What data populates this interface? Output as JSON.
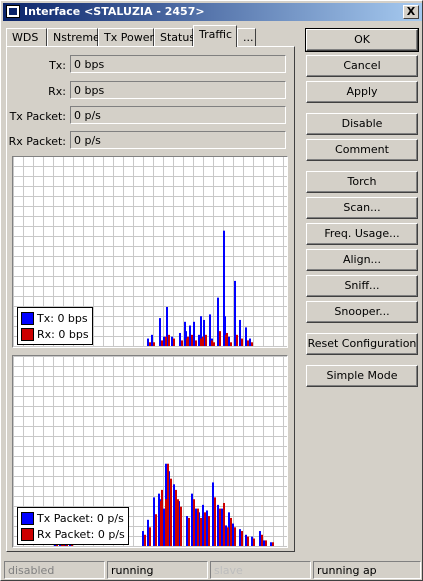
{
  "window": {
    "title": "Interface <STALUZIA - 2457>",
    "close_label": "X"
  },
  "tabs": [
    "WDS",
    "Nstreme",
    "Tx Power",
    "Status",
    "Traffic",
    "..."
  ],
  "active_tab": "Traffic",
  "fields": [
    {
      "label": "Tx:",
      "value": "0 bps"
    },
    {
      "label": "Rx:",
      "value": "0 bps"
    },
    {
      "label": "Tx Packet:",
      "value": "0 p/s"
    },
    {
      "label": "Rx Packet:",
      "value": "0 p/s"
    }
  ],
  "graphs": {
    "traffic": {
      "legend": [
        {
          "label": "Tx:",
          "value": "0 bps",
          "color": "#0000ff"
        },
        {
          "label": "Rx:",
          "value": "0 bps",
          "color": "#cc0000"
        }
      ]
    },
    "packets": {
      "legend": [
        {
          "label": "Tx Packet:",
          "value": "0 p/s",
          "color": "#0000ff"
        },
        {
          "label": "Rx Packet:",
          "value": "0 p/s",
          "color": "#cc0000"
        }
      ]
    }
  },
  "chart_data": [
    {
      "type": "bar",
      "name": "traffic-graph",
      "ylim": [
        0,
        100
      ],
      "grid": true,
      "x": [
        134,
        138,
        146,
        150,
        153,
        158,
        166,
        171,
        172,
        176,
        180,
        185,
        187,
        190,
        196,
        198,
        204,
        210,
        211,
        215,
        221,
        226,
        232,
        236
      ],
      "series": [
        {
          "name": "Tx",
          "color": "#0000ff",
          "values": [
            4,
            6,
            15,
            5,
            21,
            5,
            7,
            13,
            8,
            11,
            13,
            6,
            16,
            14,
            17,
            4,
            26,
            62,
            16,
            5,
            35,
            14,
            10,
            4
          ]
        },
        {
          "name": "Rx",
          "color": "#cc0000",
          "values": [
            2,
            2,
            3,
            5,
            6,
            4,
            3,
            4,
            5,
            6,
            3,
            4,
            5,
            6,
            3,
            2,
            8,
            6,
            7,
            2,
            6,
            4,
            3,
            2
          ]
        }
      ]
    },
    {
      "type": "bar",
      "name": "packet-graph",
      "ylim": [
        0,
        100
      ],
      "grid": true,
      "x": [
        41,
        46,
        48,
        51,
        56,
        129,
        134,
        140,
        145,
        146,
        150,
        152,
        155,
        160,
        162,
        165,
        173,
        178,
        182,
        185,
        189,
        193,
        199,
        204,
        208,
        212,
        215,
        219,
        226,
        232,
        238,
        246,
        250,
        257
      ],
      "series": [
        {
          "name": "Tx Packet",
          "color": "#0000ff",
          "values": [
            6,
            7,
            6,
            9,
            4,
            8,
            14,
            26,
            28,
            25,
            20,
            44,
            40,
            33,
            28,
            24,
            16,
            28,
            20,
            18,
            22,
            19,
            34,
            22,
            20,
            11,
            18,
            12,
            9,
            6,
            5,
            8,
            3,
            2
          ]
        },
        {
          "name": "Rx Packet",
          "color": "#cc0000",
          "values": [
            8,
            7,
            10,
            5,
            3,
            6,
            10,
            17,
            24,
            30,
            25,
            44,
            36,
            30,
            25,
            21,
            15,
            25,
            20,
            15,
            18,
            16,
            26,
            20,
            23,
            10,
            15,
            10,
            8,
            5,
            4,
            6,
            3,
            2
          ]
        }
      ]
    }
  ],
  "buttons": [
    "OK",
    "Cancel",
    "Apply",
    "Disable",
    "Comment",
    "Torch",
    "Scan...",
    "Freq. Usage...",
    "Align...",
    "Sniff...",
    "Snooper...",
    "Reset Configuration",
    "Simple Mode"
  ],
  "status": [
    "disabled",
    "running",
    "slave",
    "running ap"
  ]
}
